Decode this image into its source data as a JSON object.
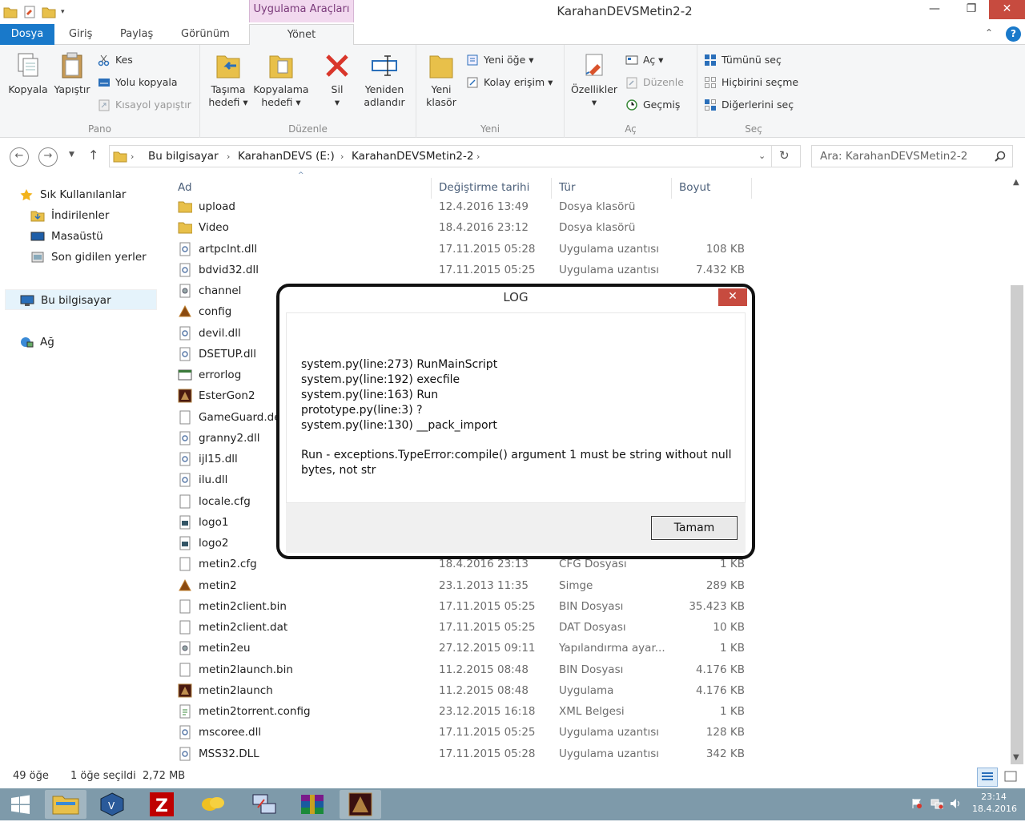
{
  "window": {
    "title": "KarahanDEVSMetin2-2",
    "context_tab": "Uygulama Araçları",
    "controls": {
      "minimize": "—",
      "maximize": "❐",
      "close": "✕"
    }
  },
  "tabs": [
    {
      "label": "Dosya"
    },
    {
      "label": "Giriş"
    },
    {
      "label": "Paylaş"
    },
    {
      "label": "Görünüm"
    },
    {
      "label": "Yönet"
    }
  ],
  "ribbon": {
    "pano": {
      "label": "Pano",
      "copy": "Kopyala",
      "paste": "Yapıştır",
      "cut": "Kes",
      "copy_path": "Yolu kopyala",
      "paste_shortcut": "Kısayol yapıştır"
    },
    "duzenle": {
      "label": "Düzenle",
      "move_to_1": "Taşıma",
      "move_to_2": "hedefi ▾",
      "copy_to_1": "Kopyalama",
      "copy_to_2": "hedefi ▾",
      "delete_1": "Sil",
      "delete_2": "▾",
      "rename_1": "Yeniden",
      "rename_2": "adlandır"
    },
    "yeni": {
      "label": "Yeni",
      "new_folder_1": "Yeni",
      "new_folder_2": "klasör",
      "new_item": "Yeni öğe ▾",
      "easy_access": "Kolay erişim ▾"
    },
    "ac": {
      "label": "Aç",
      "properties_1": "Özellikler",
      "properties_2": "▾",
      "open": "Aç ▾",
      "edit": "Düzenle",
      "history": "Geçmiş"
    },
    "sec": {
      "label": "Seç",
      "select_all": "Tümünü seç",
      "select_none": "Hiçbirini seçme",
      "invert": "Diğerlerini seç"
    }
  },
  "address": {
    "crumbs": [
      "Bu bilgisayar",
      "KarahanDEVS (E:)",
      "KarahanDEVSMetin2-2"
    ],
    "search_placeholder": "Ara: KarahanDEVSMetin2-2"
  },
  "nav": {
    "favorites": "Sık Kullanılanlar",
    "downloads": "İndirilenler",
    "desktop": "Masaüstü",
    "recent": "Son gidilen yerler",
    "this_pc": "Bu bilgisayar",
    "network": "Ağ"
  },
  "columns": {
    "name": "Ad",
    "date": "Değiştirme tarihi",
    "type": "Tür",
    "size": "Boyut"
  },
  "files": [
    {
      "name": "upload",
      "date": "12.4.2016 13:49",
      "type": "Dosya klasörü",
      "size": "",
      "icon": "folder"
    },
    {
      "name": "Video",
      "date": "18.4.2016 23:12",
      "type": "Dosya klasörü",
      "size": "",
      "icon": "folder"
    },
    {
      "name": "artpclnt.dll",
      "date": "17.11.2015 05:28",
      "type": "Uygulama uzantısı",
      "size": "108 KB",
      "icon": "dll"
    },
    {
      "name": "bdvid32.dll",
      "date": "17.11.2015 05:25",
      "type": "Uygulama uzantısı",
      "size": "7.432 KB",
      "icon": "dll"
    },
    {
      "name": "channel",
      "date": "",
      "type": "",
      "size": "",
      "icon": "config"
    },
    {
      "name": "config",
      "date": "",
      "type": "",
      "size": "",
      "icon": "app"
    },
    {
      "name": "devil.dll",
      "date": "",
      "type": "",
      "size": "",
      "icon": "dll"
    },
    {
      "name": "DSETUP.dll",
      "date": "",
      "type": "",
      "size": "",
      "icon": "dll"
    },
    {
      "name": "errorlog",
      "date": "",
      "type": "",
      "size": "",
      "icon": "log"
    },
    {
      "name": "EsterGon2",
      "date": "",
      "type": "",
      "size": "",
      "icon": "game"
    },
    {
      "name": "GameGuard.de",
      "date": "",
      "type": "",
      "size": "",
      "icon": "file"
    },
    {
      "name": "granny2.dll",
      "date": "",
      "type": "",
      "size": "",
      "icon": "dll"
    },
    {
      "name": "ijl15.dll",
      "date": "",
      "type": "",
      "size": "",
      "icon": "dll"
    },
    {
      "name": "ilu.dll",
      "date": "",
      "type": "",
      "size": "",
      "icon": "dll"
    },
    {
      "name": "locale.cfg",
      "date": "",
      "type": "",
      "size": "",
      "icon": "file"
    },
    {
      "name": "logo1",
      "date": "",
      "type": "",
      "size": "",
      "icon": "image"
    },
    {
      "name": "logo2",
      "date": "",
      "type": "",
      "size": "",
      "icon": "image"
    },
    {
      "name": "metin2.cfg",
      "date": "18.4.2016 23:13",
      "type": "CFG Dosyası",
      "size": "1 KB",
      "icon": "file"
    },
    {
      "name": "metin2",
      "date": "23.1.2013 11:35",
      "type": "Simge",
      "size": "289 KB",
      "icon": "app"
    },
    {
      "name": "metin2client.bin",
      "date": "17.11.2015 05:25",
      "type": "BIN Dosyası",
      "size": "35.423 KB",
      "icon": "file"
    },
    {
      "name": "metin2client.dat",
      "date": "17.11.2015 05:25",
      "type": "DAT Dosyası",
      "size": "10 KB",
      "icon": "file"
    },
    {
      "name": "metin2eu",
      "date": "27.12.2015 09:11",
      "type": "Yapılandırma ayar...",
      "size": "1 KB",
      "icon": "config"
    },
    {
      "name": "metin2launch.bin",
      "date": "11.2.2015 08:48",
      "type": "BIN Dosyası",
      "size": "4.176 KB",
      "icon": "file"
    },
    {
      "name": "metin2launch",
      "date": "11.2.2015 08:48",
      "type": "Uygulama",
      "size": "4.176 KB",
      "icon": "game"
    },
    {
      "name": "metin2torrent.config",
      "date": "23.12.2015 16:18",
      "type": "XML Belgesi",
      "size": "1 KB",
      "icon": "xml"
    },
    {
      "name": "mscoree.dll",
      "date": "17.11.2015 05:25",
      "type": "Uygulama uzantısı",
      "size": "128 KB",
      "icon": "dll"
    },
    {
      "name": "MSS32.DLL",
      "date": "17.11.2015 05:28",
      "type": "Uygulama uzantısı",
      "size": "342 KB",
      "icon": "dll"
    }
  ],
  "status": {
    "count": "49 öğe",
    "selection": "1 öğe seçildi  2,72 MB"
  },
  "dialog": {
    "title": "LOG",
    "lines": [
      "system.py(line:273) RunMainScript",
      "system.py(line:192) execfile",
      "system.py(line:163) Run",
      "prototype.py(line:3) ?",
      "system.py(line:130) __pack_import",
      "Run - exceptions.TypeError:compile() argument 1 must be string without null",
      "bytes, not str"
    ],
    "ok": "Tamam",
    "close": "✕"
  },
  "taskbar": {
    "time": "23:14",
    "date": "18.4.2016"
  },
  "colors": {
    "accent": "#1979ca",
    "close": "#c74b3f",
    "taskbar": "#7e9aaa"
  }
}
